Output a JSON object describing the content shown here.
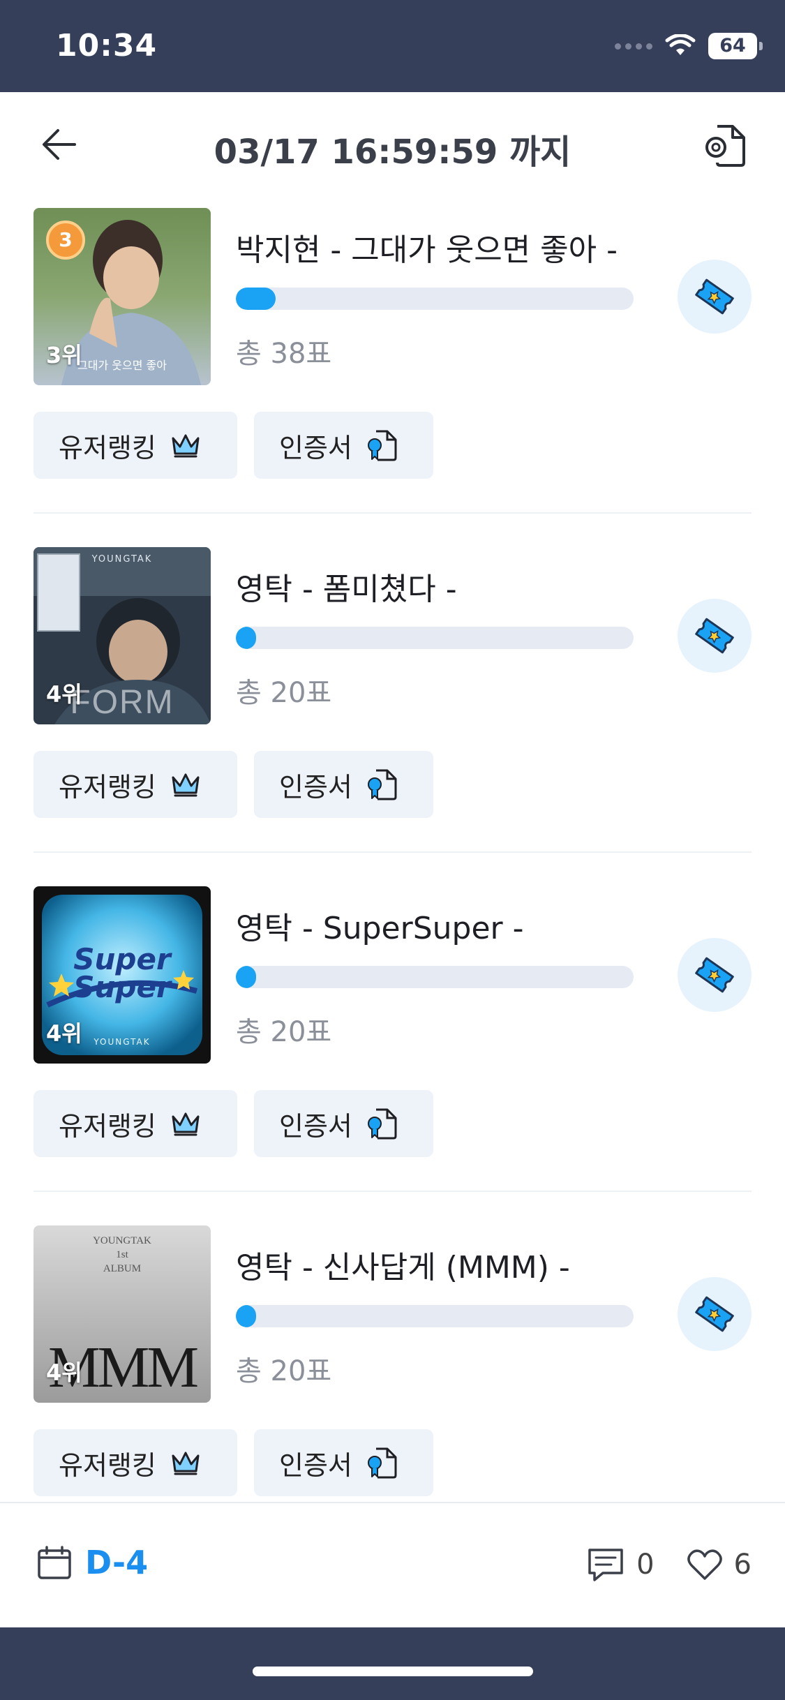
{
  "status_bar": {
    "time": "10:34",
    "battery": "64"
  },
  "header": {
    "title": "03/17 16:59:59 까지"
  },
  "items": [
    {
      "title": "박지현 - 그대가 웃으면 좋아 -",
      "rank_label": "3위",
      "medal": "3",
      "votes": "총 38표",
      "progress": 0.1
    },
    {
      "title": "영탁 - 폼미쳤다 -",
      "rank_label": "4위",
      "votes": "총 20표",
      "progress": 0.05
    },
    {
      "title": "영탁 - SuperSuper -",
      "rank_label": "4위",
      "votes": "총 20표",
      "progress": 0.05
    },
    {
      "title": "영탁 - 신사답게 (MMM) -",
      "rank_label": "4위",
      "votes": "총 20표",
      "progress": 0.05
    }
  ],
  "album_art_text": {
    "item0": "그대가 웃으면 좋아",
    "item1_brand": "YOUNGTAK",
    "item1_word": "FORM",
    "item2_line1": "Super",
    "item2_line2": "Super",
    "item2_brand": "YOUNGTAK",
    "item3_line1": "YOUNGTAK",
    "item3_line2": "1st",
    "item3_line3": "ALBUM",
    "item3_word": "MMM"
  },
  "buttons": {
    "user_ranking": "유저랭킹",
    "certificate": "인증서"
  },
  "footer": {
    "dday": "D-4",
    "comments": "0",
    "likes": "6"
  },
  "colors": {
    "accent": "#1aa3f5",
    "dday": "#1a8ff0",
    "status_bar": "#353f5a",
    "chip_bg": "#eef2f9"
  },
  "icons": [
    "back-arrow-icon",
    "certificate-settings-icon",
    "ticket-icon",
    "crown-icon",
    "certificate-icon",
    "calendar-icon",
    "comment-icon",
    "heart-icon",
    "wifi-icon"
  ]
}
